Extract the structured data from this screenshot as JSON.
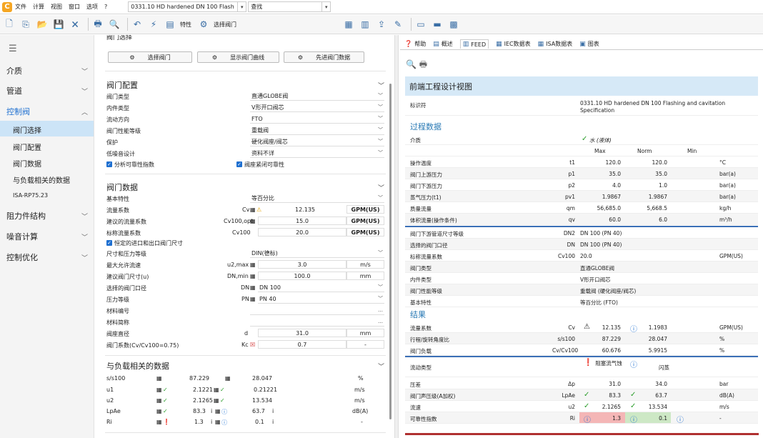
{
  "menu": {
    "items": [
      "文件",
      "计算",
      "视图",
      "窗口",
      "选项",
      "?"
    ],
    "project": "0331.10 HD  hardened DN 100 Flash",
    "search_label": "查找"
  },
  "toolbar": {
    "props": "特性",
    "select_valve": "选择阀门"
  },
  "sidebar": {
    "items": [
      {
        "label": "介质"
      },
      {
        "label": "管道"
      },
      {
        "label": "控制阀"
      },
      {
        "label": "阻力件结构"
      },
      {
        "label": "噪音计算"
      },
      {
        "label": "控制优化"
      }
    ],
    "sub": [
      "阀门选择",
      "阀门配置",
      "阀门数据",
      "与负载相关的数据",
      "ISA-RP75.23"
    ]
  },
  "mid": {
    "cut_title": "阀门选择",
    "buttons": {
      "select": "选择阀门",
      "show_curve": "显示阀门曲线",
      "advanced": "先进阀门数据"
    },
    "config": {
      "title": "阀门配置",
      "rows": [
        {
          "label": "阀门类型",
          "value": "直通GLOBE阀"
        },
        {
          "label": "内件类型",
          "value": "V形开口阀芯"
        },
        {
          "label": "流动方向",
          "value": "FTO"
        },
        {
          "label": "阀门性能等级",
          "value": "重载阀"
        },
        {
          "label": "保护",
          "value": "硬化阀座/阀芯"
        },
        {
          "label": "低噪音设计",
          "value": "资料不详"
        }
      ],
      "cb1": "分析可靠性指数",
      "cb2": "阀座紧闭可靠性"
    },
    "data": {
      "title": "阀门数据",
      "basic_label": "基本特性",
      "basic_value": "等百分比",
      "flow_label": "流量系数",
      "flow_sym": "Cv",
      "flow_val": "12.135",
      "flow_unit": "GPM(US)",
      "sugg_label": "建议的流量系数",
      "sugg_sym": "Cv100,opt",
      "sugg_val": "15.0",
      "sugg_unit": "GPM(US)",
      "nom_label": "标称流量系数",
      "nom_sym": "Cv100",
      "nom_val": "20.0",
      "nom_unit": "GPM(US)",
      "cb3": "恒定的进口和出口阀门尺寸",
      "std_label": "尺寸和压力等级",
      "std_value": "DIN(德标)",
      "vmax_label": "最大允许流速",
      "vmax_sym": "u2,max",
      "vmax_val": "3.0",
      "vmax_unit": "m/s",
      "dnmin_label": "建议阀门尺寸(u)",
      "dnmin_sym": "DN,min",
      "dnmin_val": "100.0",
      "dnmin_unit": "mm",
      "dn_label": "选择的阀门口径",
      "dn_sym": "DN",
      "dn_value": "DN 100",
      "pn_label": "压力等级",
      "pn_sym": "PN",
      "pn_value": "PN 40",
      "mat_no": "材料编号",
      "mat_abbr": "材料简称",
      "seat_label": "阀座直径",
      "seat_sym": "d",
      "seat_val": "31.0",
      "seat_unit": "mm",
      "kc_label": "阀门系数(Cv/Cv100=0.75)",
      "kc_sym": "Kc",
      "kc_val": "0.7",
      "kc_unit": "-"
    },
    "load": {
      "title": "与负载相关的数据",
      "rows": [
        {
          "label": "s/s100",
          "v1": "87.229",
          "v2": "28.047",
          "unit": "%"
        },
        {
          "label": "u1",
          "v1": "2.1221",
          "v2": "0.21221",
          "unit": "m/s"
        },
        {
          "label": "u2",
          "v1": "2.1265",
          "v2": "13.534",
          "unit": "m/s"
        },
        {
          "label": "LpAe",
          "v1": "83.3",
          "v2": "63.7",
          "unit": "dB(A)"
        },
        {
          "label": "Ri",
          "v1": "1.3",
          "v2": "0.1",
          "unit": "-"
        }
      ]
    }
  },
  "right": {
    "tabs": [
      "帮助",
      "概述",
      "FEED",
      "IEC数据表",
      "ISA数据表",
      "图表"
    ],
    "header": "前端工程设计视图",
    "id_label": "标识符",
    "id_value": "0331.10 HD hardened DN 100 Flashing and cavitation Specification",
    "process_title": "过程数据",
    "medium_label": "介质",
    "medium_value": "水 (液体)",
    "col_max": "Max",
    "col_norm": "Norm",
    "col_min": "Min",
    "process_rows": [
      {
        "label": "操作温度",
        "sym": "t1",
        "max": "120.0",
        "norm": "120.0",
        "unit": "°C"
      },
      {
        "label": "阀门上游压力",
        "sym": "p1",
        "max": "35.0",
        "norm": "35.0",
        "unit": "bar(a)"
      },
      {
        "label": "阀门下游压力",
        "sym": "p2",
        "max": "4.0",
        "norm": "1.0",
        "unit": "bar(a)"
      },
      {
        "label": "蒸气压力(t1)",
        "sym": "pv1",
        "max": "1.9867",
        "norm": "1.9867",
        "unit": "bar(a)"
      },
      {
        "label": "质量流量",
        "sym": "qm",
        "max": "56,685.0",
        "norm": "5,668.5",
        "unit": "kg/h"
      },
      {
        "label": "体积流量(操作条件)",
        "sym": "qv",
        "max": "60.0",
        "norm": "6.0",
        "unit": "m³/h"
      }
    ],
    "valve_rows": [
      {
        "label": "阀门下游管道尺寸等级",
        "sym": "DN2",
        "value": "DN 100 (PN 40)",
        "unit": ""
      },
      {
        "label": "选择的阀门口径",
        "sym": "DN",
        "value": "DN 100 (PN 40)",
        "unit": ""
      },
      {
        "label": "标称流量系数",
        "sym": "Cv100",
        "value": "20.0",
        "unit": "GPM(US)"
      },
      {
        "label": "阀门类型",
        "sym": "",
        "value": "直通GLOBE阀",
        "unit": ""
      },
      {
        "label": "内件类型",
        "sym": "",
        "value": "V形开口阀芯",
        "unit": ""
      },
      {
        "label": "阀门性能等级",
        "sym": "",
        "value": "重载阀 (硬化阀座/阀芯)",
        "unit": ""
      },
      {
        "label": "基本特性",
        "sym": "",
        "value": "等百分比 (FTO)",
        "unit": ""
      }
    ],
    "results_title": "结果",
    "result_rows": [
      {
        "label": "流量系数",
        "sym": "Cv",
        "max": "12.135",
        "norm": "1.1983",
        "unit": "GPM(US)"
      },
      {
        "label": "行程/旋转角度比",
        "sym": "s/s100",
        "max": "87.229",
        "norm": "28.047",
        "unit": "%"
      },
      {
        "label": "阀门负载",
        "sym": "Cv/Cv100",
        "max": "60.676",
        "norm": "5.9915",
        "unit": "%"
      }
    ],
    "flow_type_label": "流动类型",
    "flow_type_max": "阻塞流气蚀",
    "flow_type_norm": "闪蒸",
    "result_rows2": [
      {
        "label": "压差",
        "sym": "Δp",
        "max": "31.0",
        "norm": "34.0",
        "unit": "bar"
      },
      {
        "label": "阀门声压级(A加权)",
        "sym": "LpAe",
        "max": "83.3",
        "norm": "63.7",
        "unit": "dB(A)"
      },
      {
        "label": "流速",
        "sym": "u2",
        "max": "2.1265",
        "norm": "13.534",
        "unit": "m/s"
      },
      {
        "label": "可靠性指数",
        "sym": "Ri",
        "max": "1.3",
        "norm": "0.1",
        "unit": "-"
      }
    ]
  },
  "colors": {
    "accent": "#1e6fd0",
    "header_bg": "#d6e9f7",
    "section_blue": "#2a7ab5",
    "warn_red": "#f4b6b6",
    "ok_green": "#cde8c5"
  }
}
